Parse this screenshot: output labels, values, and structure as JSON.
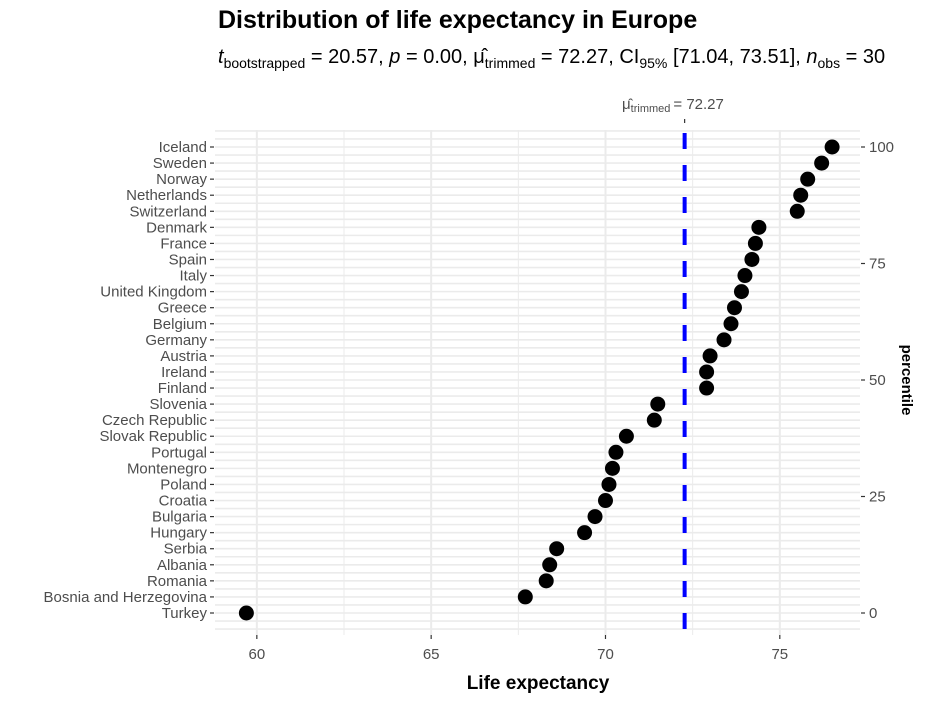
{
  "chart_data": {
    "type": "scatter",
    "title": "Distribution of life expectancy in Europe",
    "subtitle": {
      "t_label": "t",
      "t_sub": "bootstrapped",
      "t_value": "20.57",
      "p_label": "p",
      "p_value": "0.00",
      "mu_label": "μ̂",
      "mu_sub": "trimmed",
      "mu_value": "72.27",
      "ci_label": "CI",
      "ci_sub": "95%",
      "ci_value": "[71.04, 73.51]",
      "n_label": "n",
      "n_sub": "obs",
      "n_value": "30"
    },
    "xlabel": "Life expectancy",
    "ylabel_right": "percentile",
    "xlim": [
      58.8,
      77.3
    ],
    "xticks": [
      60,
      65,
      70,
      75
    ],
    "yticks_right": [
      0,
      25,
      50,
      75,
      100
    ],
    "reference_line": {
      "value": 72.27,
      "label_mu": "μ̂",
      "label_sub": "trimmed",
      "label_value": "= 72.27",
      "color": "#0000ff",
      "style": "dashed"
    },
    "point_color": "#000000",
    "countries": [
      "Iceland",
      "Sweden",
      "Norway",
      "Netherlands",
      "Switzerland",
      "Denmark",
      "France",
      "Spain",
      "Italy",
      "United Kingdom",
      "Greece",
      "Belgium",
      "Germany",
      "Austria",
      "Ireland",
      "Finland",
      "Slovenia",
      "Czech Republic",
      "Slovak Republic",
      "Portugal",
      "Montenegro",
      "Poland",
      "Croatia",
      "Bulgaria",
      "Hungary",
      "Serbia",
      "Albania",
      "Romania",
      "Bosnia and Herzegovina",
      "Turkey"
    ],
    "values": [
      76.5,
      76.2,
      75.8,
      75.6,
      75.5,
      74.4,
      74.3,
      74.2,
      74.0,
      73.9,
      73.7,
      73.6,
      73.4,
      73.0,
      72.9,
      72.9,
      71.5,
      71.4,
      70.6,
      70.3,
      70.2,
      70.1,
      70.0,
      69.7,
      69.4,
      68.6,
      68.4,
      68.3,
      67.7,
      59.7
    ],
    "grid": true
  }
}
